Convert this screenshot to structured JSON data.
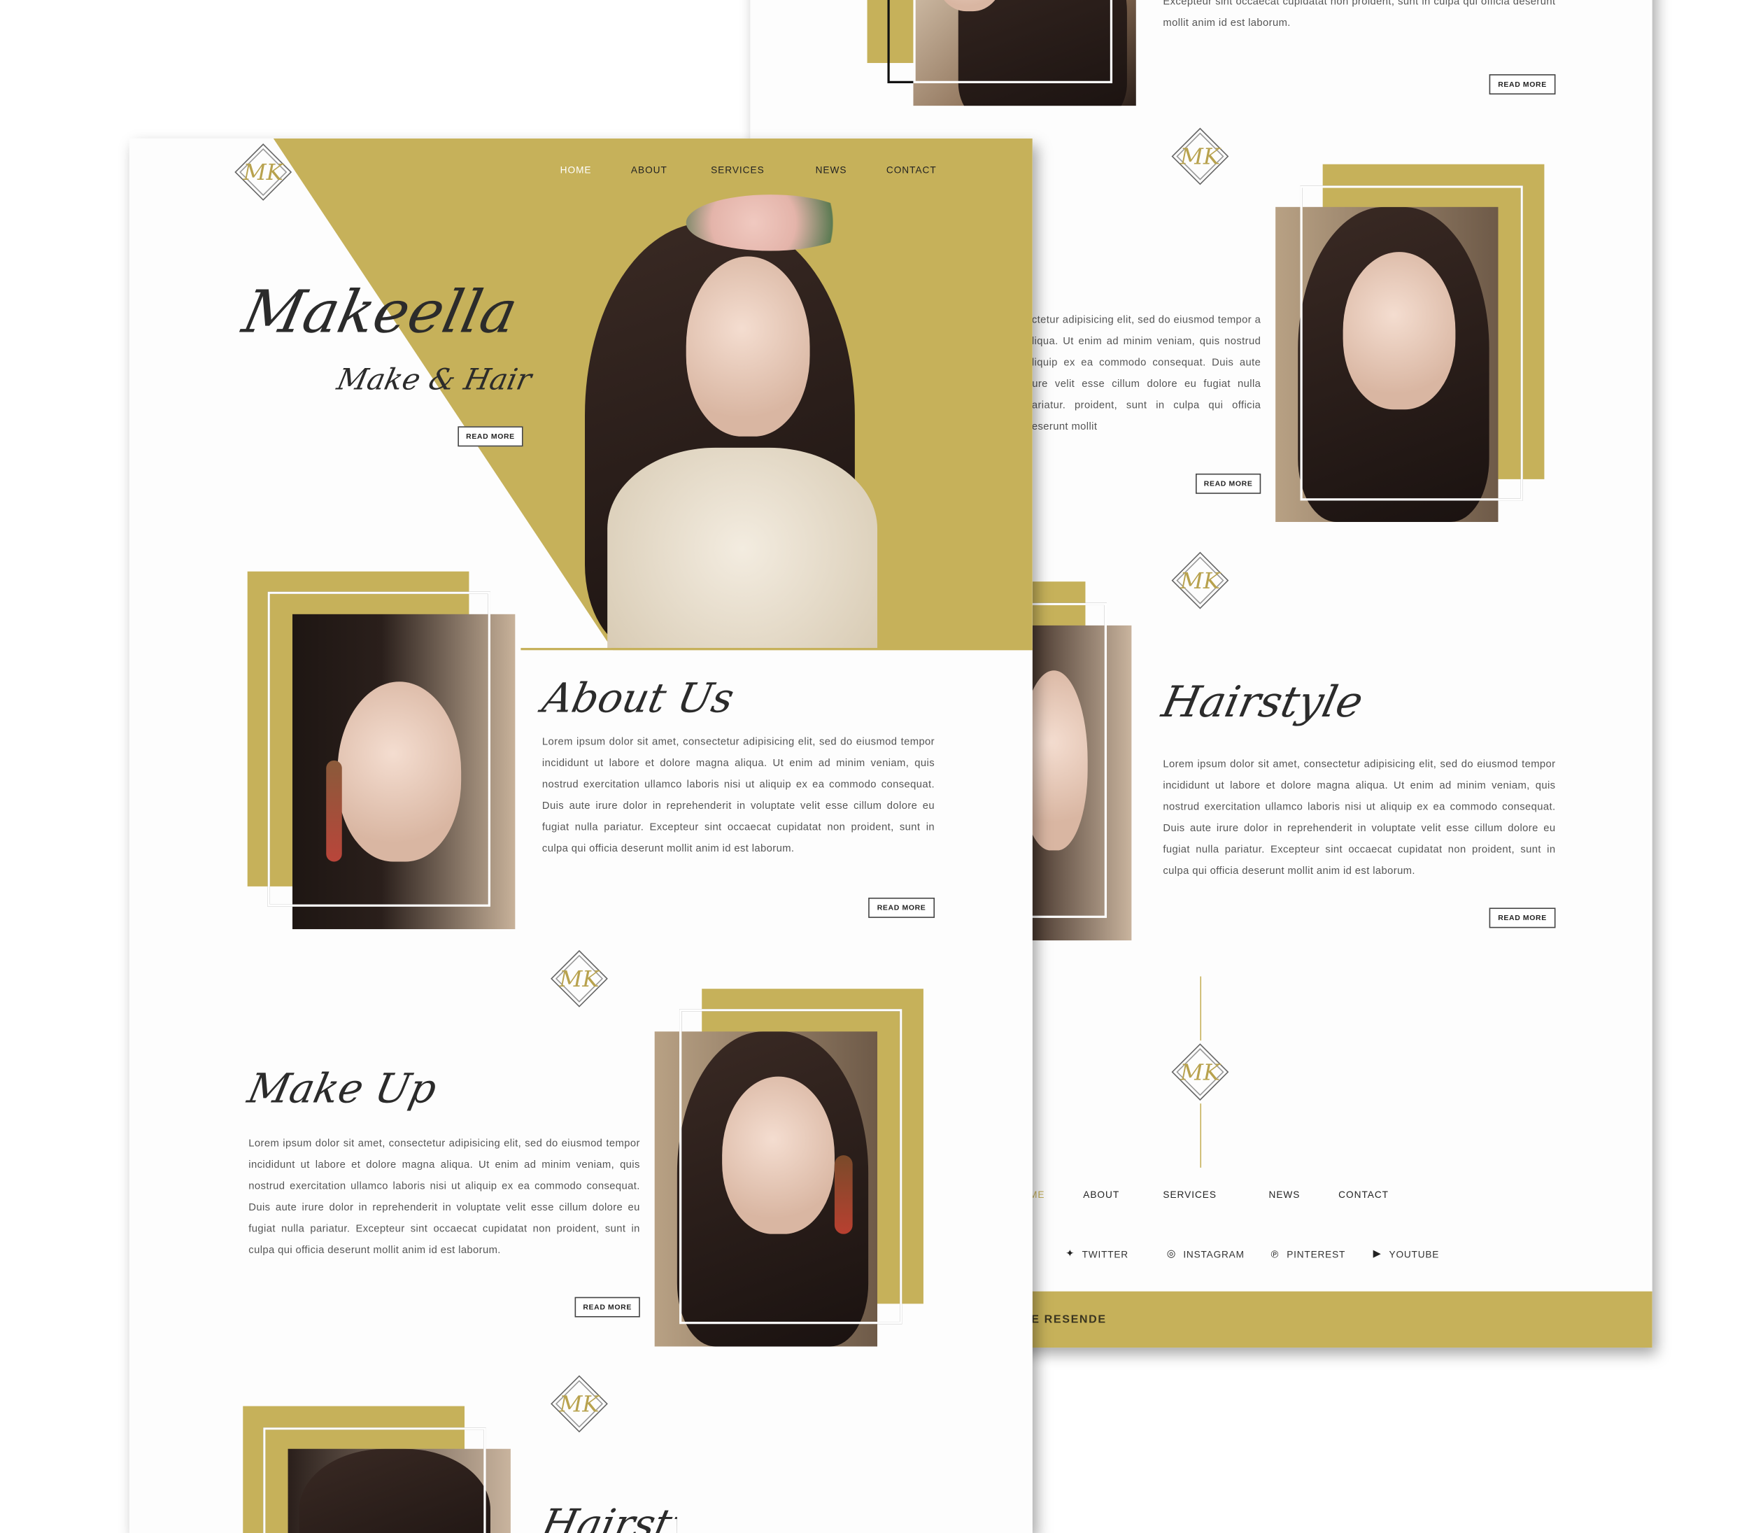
{
  "brand": {
    "name": "Makeella",
    "tagline": "Make & Hair",
    "logo_mark": "MK",
    "gold": "#c6b15a",
    "dark": "#2b2b2b"
  },
  "nav": [
    "HOME",
    "ABOUT",
    "SERVICES",
    "NEWS",
    "CONTACT"
  ],
  "footer_nav": [
    "ME",
    "ABOUT",
    "SERVICES",
    "NEWS",
    "CONTACT"
  ],
  "hero": {
    "read_more": "READ MORE"
  },
  "sections": {
    "about": {
      "title": "About Us",
      "body": "Lorem ipsum dolor sit amet, consectetur adipisicing elit, sed do eiusmod tempor incididunt ut labore et dolore magna aliqua. Ut enim ad minim veniam, quis nostrud exercitation ullamco laboris nisi ut aliquip ex ea commodo consequat. Duis aute irure dolor in reprehenderit in voluptate velit esse cillum dolore eu fugiat nulla pariatur. Excepteur sint occaecat cupidatat non proident, sunt in culpa qui officia deserunt mollit anim id est laborum.",
      "read_more": "READ MORE"
    },
    "makeup": {
      "title": "Make Up",
      "body": "Lorem ipsum dolor sit amet, consectetur adipisicing elit, sed do eiusmod tempor incididunt ut labore et dolore magna aliqua. Ut enim ad minim veniam, quis nostrud exercitation ullamco laboris nisi ut aliquip ex ea commodo consequat. Duis aute irure dolor in reprehenderit in voluptate velit esse cillum dolore eu fugiat nulla pariatur. Excepteur sint occaecat cupidatat non proident, sunt in culpa qui officia deserunt mollit anim id est laborum.",
      "read_more": "READ MORE"
    },
    "hairstyle": {
      "title": "Hairstyle",
      "title_partial": "Hairstyle",
      "body": "Lorem ipsum dolor sit amet, consectetur adipisicing elit, sed do eiusmod tempor incididunt ut labore et dolore magna aliqua. Ut enim ad minim veniam, quis nostrud exercitation ullamco laboris nisi ut aliquip ex ea commodo consequat. Duis aute irure dolor in reprehenderit in voluptate velit esse cillum dolore eu fugiat nulla pariatur. Excepteur sint occaecat cupidatat non proident, sunt in culpa qui officia deserunt mollit anim id est laborum.",
      "read_more": "READ MORE"
    }
  },
  "back": {
    "top_text": "Excepteur sint occaecat cupidatat non proident, sunt in culpa qui officia deserunt mollit anim id est laborum.",
    "top_read_more": "READ MORE",
    "mid_text": "ectetur adipisicing elit, sed do eiusmod tempor a aliqua. Ut enim ad minim veniam, quis nostrud aliquip ex ea commodo consequat. Duis aute irure velit esse cillum dolore eu fugiat nulla pariatur. proident, sunt in culpa qui officia deserunt mollit",
    "mid_read_more": "READ MORE"
  },
  "social": [
    {
      "icon": "twitter-icon",
      "glyph": "✦",
      "label": "TWITTER"
    },
    {
      "icon": "instagram-icon",
      "glyph": "◎",
      "label": "INSTAGRAM"
    },
    {
      "icon": "pinterest-icon",
      "glyph": "℗",
      "label": "PINTEREST"
    },
    {
      "icon": "youtube-icon",
      "glyph": "▶",
      "label": "YOUTUBE"
    }
  ],
  "footer_bar": "E RESENDE"
}
